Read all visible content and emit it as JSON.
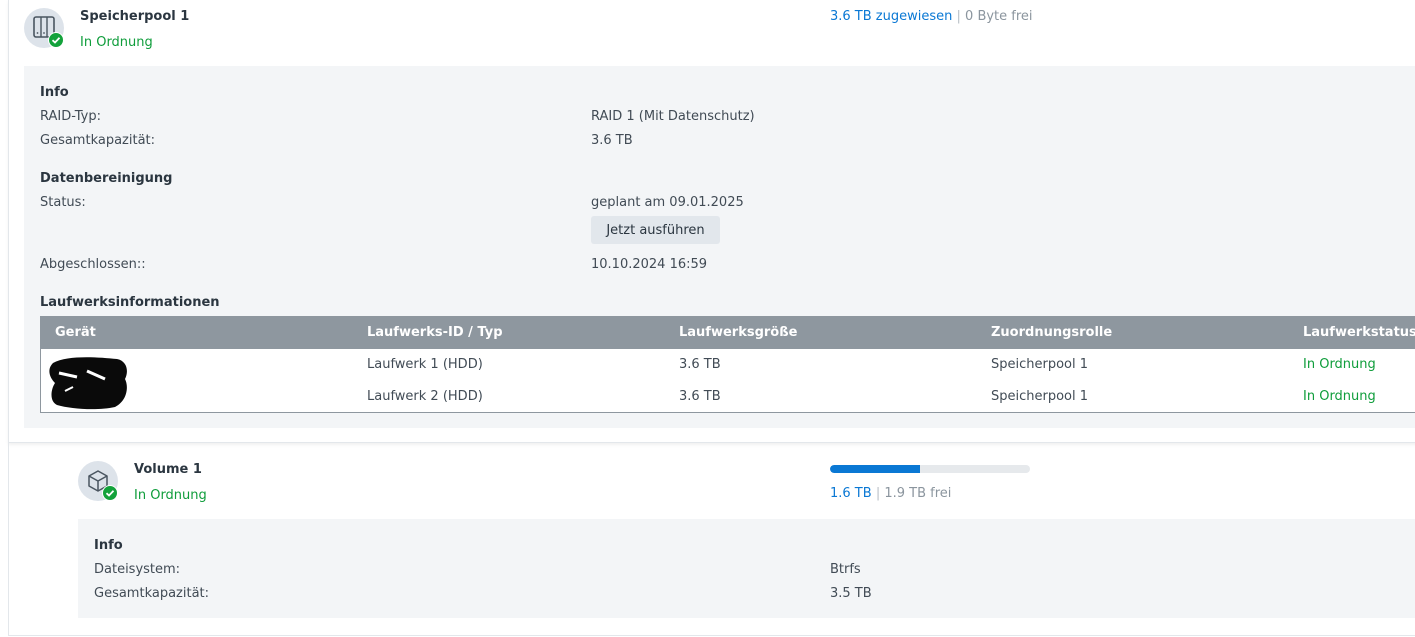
{
  "pool": {
    "name": "Speicherpool 1",
    "status": "In Ordnung",
    "allocated": "3.6 TB zugewiesen",
    "separator": "|",
    "free": "0 Byte frei",
    "info": {
      "heading": "Info",
      "raid_label": "RAID-Typ:",
      "raid_value": "RAID 1 (Mit Datenschutz)",
      "capacity_label": "Gesamtkapazität:",
      "capacity_value": "3.6 TB"
    },
    "scrub": {
      "heading": "Datenbereinigung",
      "status_label": "Status:",
      "status_value": "geplant am 09.01.2025",
      "run_button": "Jetzt ausführen",
      "completed_label": "Abgeschlossen::",
      "completed_value": "10.10.2024 16:59"
    },
    "drives": {
      "heading": "Laufwerksinformationen",
      "columns": [
        "Gerät",
        "Laufwerks-ID / Typ",
        "Laufwerksgröße",
        "Zuordnungsrolle",
        "Laufwerkstatus"
      ],
      "rows": [
        {
          "id": "Laufwerk 1 (HDD)",
          "size": "3.6 TB",
          "role": "Speicherpool 1",
          "status": "In Ordnung"
        },
        {
          "id": "Laufwerk 2 (HDD)",
          "size": "3.6 TB",
          "role": "Speicherpool 1",
          "status": "In Ordnung"
        }
      ]
    }
  },
  "volume": {
    "name": "Volume 1",
    "status": "In Ordnung",
    "used": "1.6 TB",
    "separator": "|",
    "free": "1.9 TB frei",
    "usage_fraction": 0.45,
    "info": {
      "heading": "Info",
      "fs_label": "Dateisystem:",
      "fs_value": "Btrfs",
      "capacity_label": "Gesamtkapazität:",
      "capacity_value": "3.5 TB"
    }
  },
  "colors": {
    "accent": "#0a78d4",
    "ok": "#0f9d3b",
    "table_header": "#8e979f",
    "panel": "#f3f5f7"
  },
  "icons": {
    "pool": "storage-pool-icon",
    "volume": "volume-cube-icon",
    "status": "check-circle-icon"
  }
}
